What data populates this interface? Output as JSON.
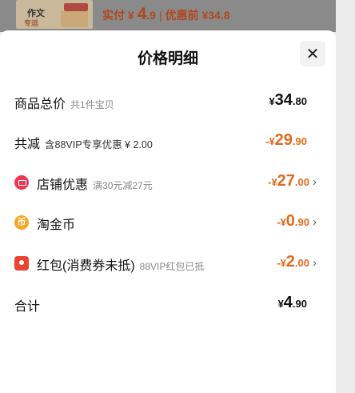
{
  "top_strip": {
    "thumb_text_1": "作文",
    "thumb_text_2": "专运",
    "price_prefix": "实付 ¥ ",
    "price_int": "4",
    "price_dec": ".9",
    "separator": "|",
    "original_label": "优惠前 ¥34.8"
  },
  "sheet": {
    "title": "价格明细",
    "close_label": "✕"
  },
  "rows": {
    "goods_total": {
      "label": "商品总价",
      "note": "共1件宝贝",
      "cur": "¥",
      "int": "34",
      "dec": ".80"
    },
    "total_discount": {
      "label": "共减",
      "note": "含88VIP专享优惠 ¥ 2.00",
      "cur": "-¥",
      "int": "29",
      "dec": ".90"
    },
    "shop_discount": {
      "label": "店铺优惠",
      "note": "满30元减27元",
      "cur": "-¥",
      "int": "27",
      "dec": ".00",
      "chevron": "›"
    },
    "taojinbi": {
      "label": "淘金币",
      "icon_glyph": "币",
      "cur": "-¥",
      "int": "0",
      "dec": ".90",
      "chevron": "›"
    },
    "red_packet": {
      "label": "红包(消费券未抵)",
      "note": "88VIP红包已抵",
      "cur": "-¥",
      "int": "2",
      "dec": ".00",
      "chevron": "›"
    },
    "total": {
      "label": "合计",
      "cur": "¥",
      "int": "4",
      "dec": ".90"
    }
  },
  "colors": {
    "accent_orange": "#e06a1c",
    "shop_icon": "#e83a55",
    "coin_icon": "#f6a623",
    "redpack_icon": "#e8442f"
  }
}
